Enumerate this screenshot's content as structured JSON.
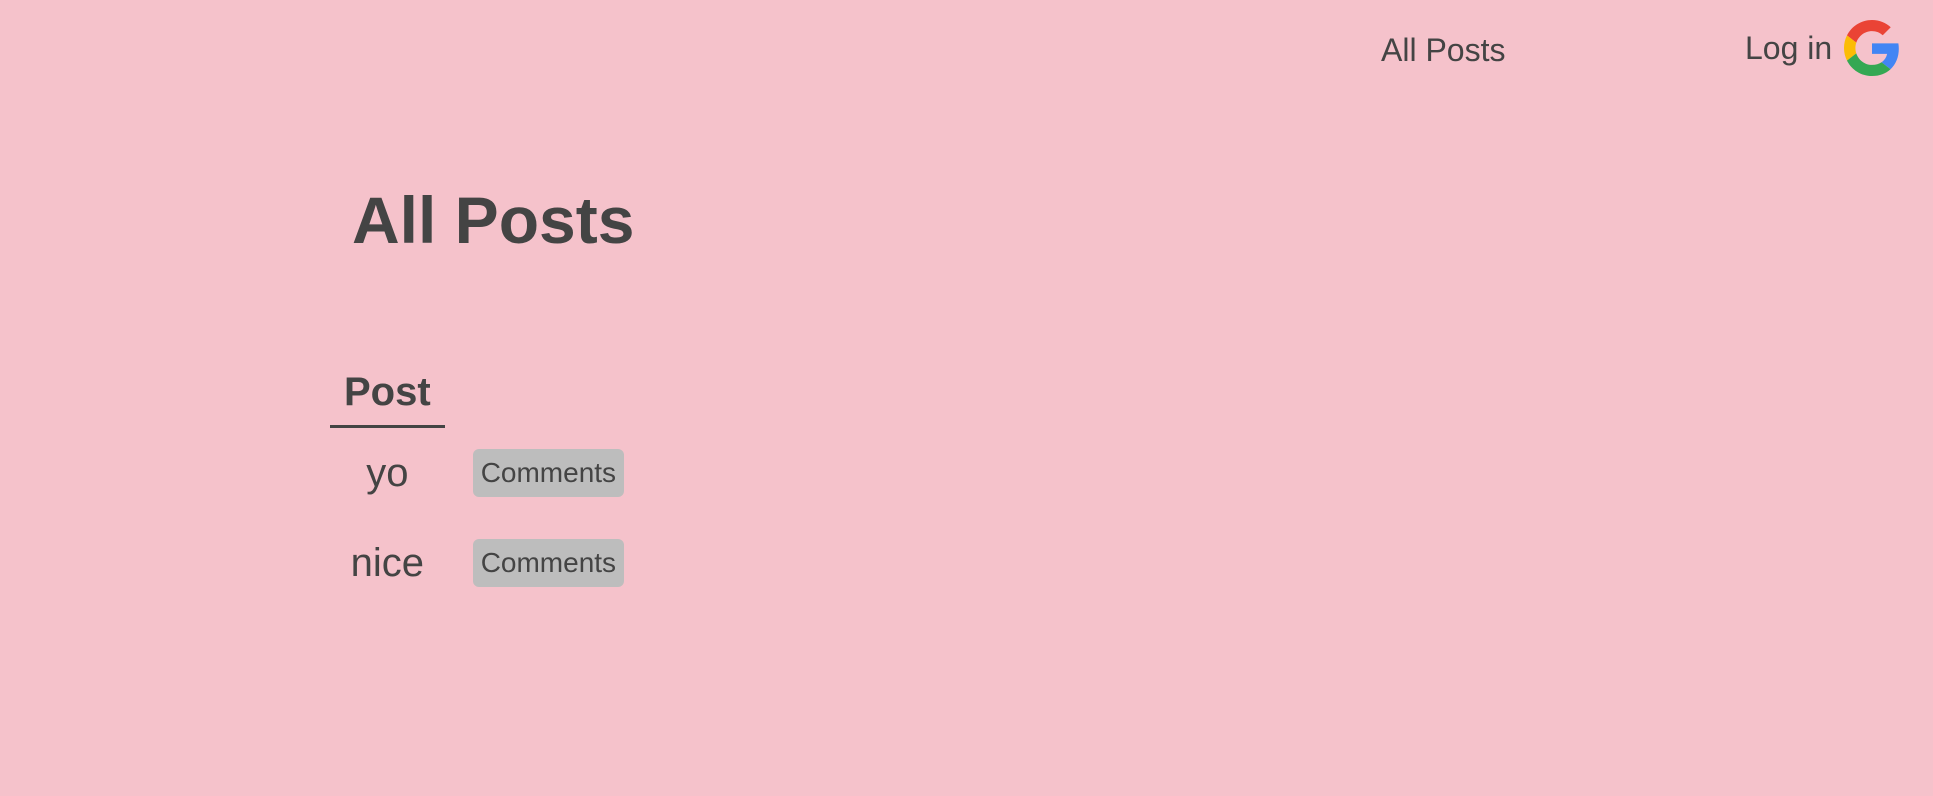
{
  "nav": {
    "all_posts": "All Posts",
    "login": "Log in",
    "login_icon": "google-g-icon"
  },
  "page": {
    "title": "All Posts"
  },
  "table": {
    "header": "Post",
    "rows": [
      {
        "post": "yo",
        "action": "Comments"
      },
      {
        "post": "nice",
        "action": "Comments"
      }
    ]
  },
  "colors": {
    "background": "#f5c2cb",
    "text": "#444444",
    "button": "#bdbdbd",
    "google_red": "#EA4335",
    "google_yellow": "#FBBC05",
    "google_green": "#34A853",
    "google_blue": "#4285F4"
  }
}
